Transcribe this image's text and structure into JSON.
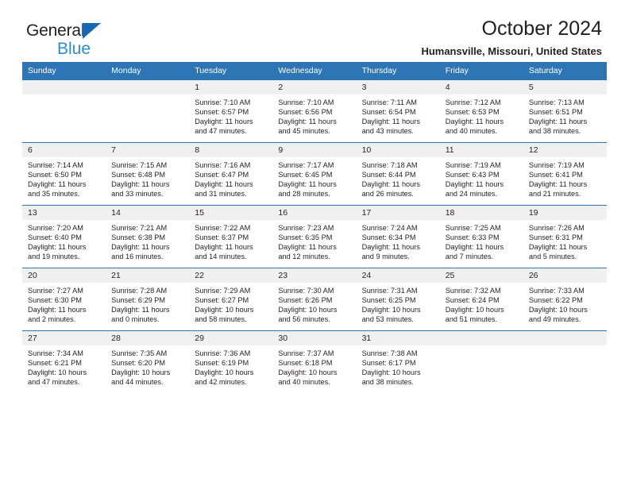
{
  "brand": {
    "name_part1": "General",
    "name_part2": "Blue",
    "triangle_color": "#1668b3",
    "blue_color": "#2e8ad4"
  },
  "header": {
    "title": "October 2024",
    "subtitle": "Humansville, Missouri, United States"
  },
  "colors": {
    "header_blue": "#2e75b6",
    "daynum_band": "#f0f0f0",
    "text": "#231f20"
  },
  "weekday_headers": [
    "Sunday",
    "Monday",
    "Tuesday",
    "Wednesday",
    "Thursday",
    "Friday",
    "Saturday"
  ],
  "weeks": [
    [
      {
        "day": "",
        "sunrise": "",
        "sunset": "",
        "daylight": "",
        "daylight2": ""
      },
      {
        "day": "",
        "sunrise": "",
        "sunset": "",
        "daylight": "",
        "daylight2": ""
      },
      {
        "day": "1",
        "sunrise": "Sunrise: 7:10 AM",
        "sunset": "Sunset: 6:57 PM",
        "daylight": "Daylight: 11 hours",
        "daylight2": "and 47 minutes."
      },
      {
        "day": "2",
        "sunrise": "Sunrise: 7:10 AM",
        "sunset": "Sunset: 6:56 PM",
        "daylight": "Daylight: 11 hours",
        "daylight2": "and 45 minutes."
      },
      {
        "day": "3",
        "sunrise": "Sunrise: 7:11 AM",
        "sunset": "Sunset: 6:54 PM",
        "daylight": "Daylight: 11 hours",
        "daylight2": "and 43 minutes."
      },
      {
        "day": "4",
        "sunrise": "Sunrise: 7:12 AM",
        "sunset": "Sunset: 6:53 PM",
        "daylight": "Daylight: 11 hours",
        "daylight2": "and 40 minutes."
      },
      {
        "day": "5",
        "sunrise": "Sunrise: 7:13 AM",
        "sunset": "Sunset: 6:51 PM",
        "daylight": "Daylight: 11 hours",
        "daylight2": "and 38 minutes."
      }
    ],
    [
      {
        "day": "6",
        "sunrise": "Sunrise: 7:14 AM",
        "sunset": "Sunset: 6:50 PM",
        "daylight": "Daylight: 11 hours",
        "daylight2": "and 35 minutes."
      },
      {
        "day": "7",
        "sunrise": "Sunrise: 7:15 AM",
        "sunset": "Sunset: 6:48 PM",
        "daylight": "Daylight: 11 hours",
        "daylight2": "and 33 minutes."
      },
      {
        "day": "8",
        "sunrise": "Sunrise: 7:16 AM",
        "sunset": "Sunset: 6:47 PM",
        "daylight": "Daylight: 11 hours",
        "daylight2": "and 31 minutes."
      },
      {
        "day": "9",
        "sunrise": "Sunrise: 7:17 AM",
        "sunset": "Sunset: 6:45 PM",
        "daylight": "Daylight: 11 hours",
        "daylight2": "and 28 minutes."
      },
      {
        "day": "10",
        "sunrise": "Sunrise: 7:18 AM",
        "sunset": "Sunset: 6:44 PM",
        "daylight": "Daylight: 11 hours",
        "daylight2": "and 26 minutes."
      },
      {
        "day": "11",
        "sunrise": "Sunrise: 7:19 AM",
        "sunset": "Sunset: 6:43 PM",
        "daylight": "Daylight: 11 hours",
        "daylight2": "and 24 minutes."
      },
      {
        "day": "12",
        "sunrise": "Sunrise: 7:19 AM",
        "sunset": "Sunset: 6:41 PM",
        "daylight": "Daylight: 11 hours",
        "daylight2": "and 21 minutes."
      }
    ],
    [
      {
        "day": "13",
        "sunrise": "Sunrise: 7:20 AM",
        "sunset": "Sunset: 6:40 PM",
        "daylight": "Daylight: 11 hours",
        "daylight2": "and 19 minutes."
      },
      {
        "day": "14",
        "sunrise": "Sunrise: 7:21 AM",
        "sunset": "Sunset: 6:38 PM",
        "daylight": "Daylight: 11 hours",
        "daylight2": "and 16 minutes."
      },
      {
        "day": "15",
        "sunrise": "Sunrise: 7:22 AM",
        "sunset": "Sunset: 6:37 PM",
        "daylight": "Daylight: 11 hours",
        "daylight2": "and 14 minutes."
      },
      {
        "day": "16",
        "sunrise": "Sunrise: 7:23 AM",
        "sunset": "Sunset: 6:35 PM",
        "daylight": "Daylight: 11 hours",
        "daylight2": "and 12 minutes."
      },
      {
        "day": "17",
        "sunrise": "Sunrise: 7:24 AM",
        "sunset": "Sunset: 6:34 PM",
        "daylight": "Daylight: 11 hours",
        "daylight2": "and 9 minutes."
      },
      {
        "day": "18",
        "sunrise": "Sunrise: 7:25 AM",
        "sunset": "Sunset: 6:33 PM",
        "daylight": "Daylight: 11 hours",
        "daylight2": "and 7 minutes."
      },
      {
        "day": "19",
        "sunrise": "Sunrise: 7:26 AM",
        "sunset": "Sunset: 6:31 PM",
        "daylight": "Daylight: 11 hours",
        "daylight2": "and 5 minutes."
      }
    ],
    [
      {
        "day": "20",
        "sunrise": "Sunrise: 7:27 AM",
        "sunset": "Sunset: 6:30 PM",
        "daylight": "Daylight: 11 hours",
        "daylight2": "and 2 minutes."
      },
      {
        "day": "21",
        "sunrise": "Sunrise: 7:28 AM",
        "sunset": "Sunset: 6:29 PM",
        "daylight": "Daylight: 11 hours",
        "daylight2": "and 0 minutes."
      },
      {
        "day": "22",
        "sunrise": "Sunrise: 7:29 AM",
        "sunset": "Sunset: 6:27 PM",
        "daylight": "Daylight: 10 hours",
        "daylight2": "and 58 minutes."
      },
      {
        "day": "23",
        "sunrise": "Sunrise: 7:30 AM",
        "sunset": "Sunset: 6:26 PM",
        "daylight": "Daylight: 10 hours",
        "daylight2": "and 56 minutes."
      },
      {
        "day": "24",
        "sunrise": "Sunrise: 7:31 AM",
        "sunset": "Sunset: 6:25 PM",
        "daylight": "Daylight: 10 hours",
        "daylight2": "and 53 minutes."
      },
      {
        "day": "25",
        "sunrise": "Sunrise: 7:32 AM",
        "sunset": "Sunset: 6:24 PM",
        "daylight": "Daylight: 10 hours",
        "daylight2": "and 51 minutes."
      },
      {
        "day": "26",
        "sunrise": "Sunrise: 7:33 AM",
        "sunset": "Sunset: 6:22 PM",
        "daylight": "Daylight: 10 hours",
        "daylight2": "and 49 minutes."
      }
    ],
    [
      {
        "day": "27",
        "sunrise": "Sunrise: 7:34 AM",
        "sunset": "Sunset: 6:21 PM",
        "daylight": "Daylight: 10 hours",
        "daylight2": "and 47 minutes."
      },
      {
        "day": "28",
        "sunrise": "Sunrise: 7:35 AM",
        "sunset": "Sunset: 6:20 PM",
        "daylight": "Daylight: 10 hours",
        "daylight2": "and 44 minutes."
      },
      {
        "day": "29",
        "sunrise": "Sunrise: 7:36 AM",
        "sunset": "Sunset: 6:19 PM",
        "daylight": "Daylight: 10 hours",
        "daylight2": "and 42 minutes."
      },
      {
        "day": "30",
        "sunrise": "Sunrise: 7:37 AM",
        "sunset": "Sunset: 6:18 PM",
        "daylight": "Daylight: 10 hours",
        "daylight2": "and 40 minutes."
      },
      {
        "day": "31",
        "sunrise": "Sunrise: 7:38 AM",
        "sunset": "Sunset: 6:17 PM",
        "daylight": "Daylight: 10 hours",
        "daylight2": "and 38 minutes."
      },
      {
        "day": "",
        "sunrise": "",
        "sunset": "",
        "daylight": "",
        "daylight2": ""
      },
      {
        "day": "",
        "sunrise": "",
        "sunset": "",
        "daylight": "",
        "daylight2": ""
      }
    ]
  ]
}
